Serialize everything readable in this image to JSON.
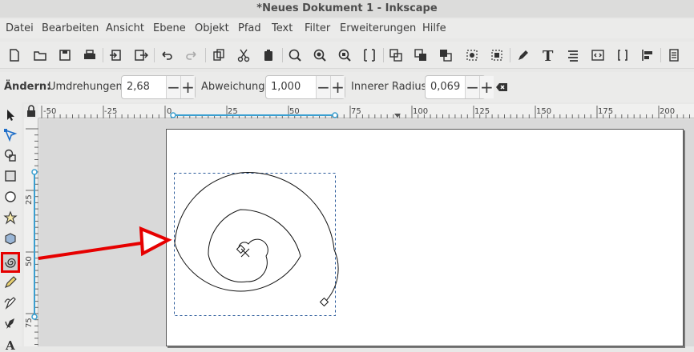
{
  "window": {
    "title": "*Neues Dokument 1 - Inkscape"
  },
  "menu": [
    "Datei",
    "Bearbeiten",
    "Ansicht",
    "Ebene",
    "Objekt",
    "Pfad",
    "Text",
    "Filter",
    "Erweiterungen",
    "Hilfe"
  ],
  "controls": {
    "mode_label": "Ändern:",
    "revolutions_label": "Umdrehungen:",
    "revolutions_value": "2,68",
    "divergence_label": "Abweichung:",
    "divergence_value": "1,000",
    "inner_radius_label": "Innerer Radius:",
    "inner_radius_value": "0,069"
  },
  "ruler_h": [
    "-50",
    "-25",
    "0",
    "25",
    "50",
    "75",
    "100",
    "125",
    "150",
    "175",
    "200"
  ],
  "ruler_v": [
    "25",
    "50",
    "75"
  ],
  "colors": {
    "annotation_red": "#e60000",
    "guide_blue": "#3a9fd0"
  }
}
